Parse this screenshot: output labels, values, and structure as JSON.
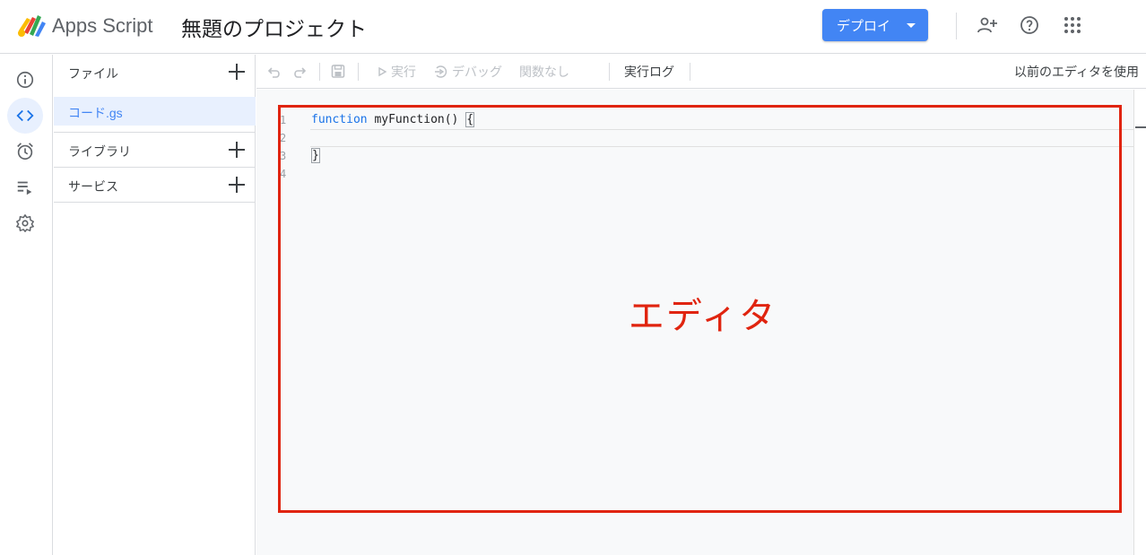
{
  "header": {
    "app_name": "Apps Script",
    "project_title": "無題のプロジェクト",
    "deploy_label": "デプロイ",
    "icons": [
      "add-person-icon",
      "help-icon",
      "apps-grid-icon"
    ],
    "accent_color": "#4285f4"
  },
  "rail": {
    "items": [
      "info-icon",
      "code-icon",
      "alarm-icon",
      "executions-icon",
      "settings-icon"
    ],
    "active": "code-icon"
  },
  "files_panel": {
    "files_label": "ファイル",
    "files": [
      "コード.gs"
    ],
    "libraries_label": "ライブラリ",
    "services_label": "サービス"
  },
  "toolbar": {
    "run_label": "実行",
    "debug_label": "デバッグ",
    "function_select": "関数なし",
    "log_label": "実行ログ",
    "legacy_editor_label": "以前のエディタを使用"
  },
  "editor": {
    "line_numbers": [
      "1",
      "2",
      "3",
      "4"
    ],
    "code": {
      "keyword": "function",
      "line1_rest": " myFunction() ",
      "line1_brace": "{",
      "line3": "}"
    }
  },
  "annotation": {
    "label": "エディタ",
    "color": "#e0240f"
  }
}
